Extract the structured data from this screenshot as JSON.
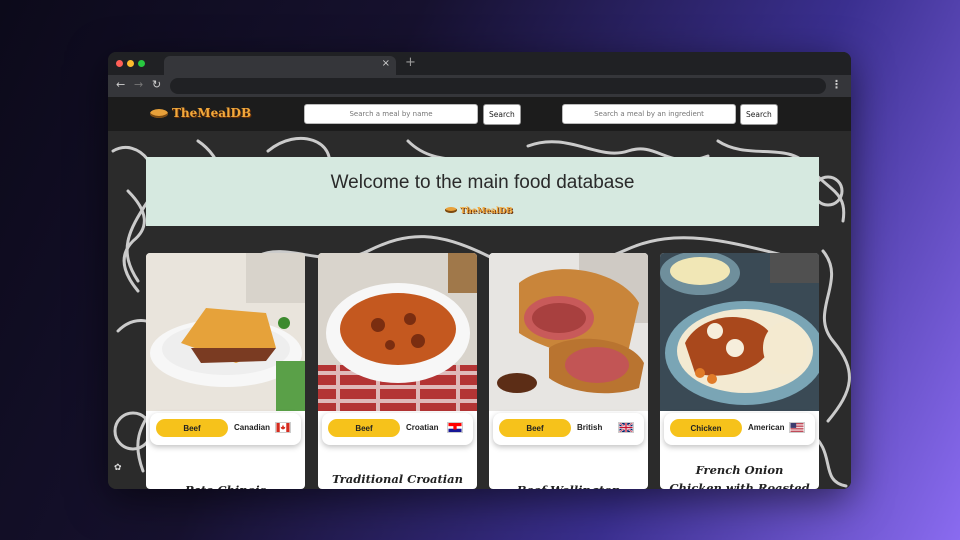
{
  "browser": {
    "tab_close": "×",
    "new_tab": "+",
    "back": "←",
    "forward": "→",
    "reload": "↻",
    "menu": "⋮",
    "url": ""
  },
  "site": {
    "logo_text": "TheMealDB",
    "search_name": {
      "placeholder": "Search a meal by name",
      "button": "Search"
    },
    "search_ingredient": {
      "placeholder": "Search a meal by an ingredient",
      "button": "Search"
    }
  },
  "hero": {
    "title": "Welcome to the main food database",
    "logo_text": "TheMealDB"
  },
  "cards": [
    {
      "category": "Beef",
      "area": "Canadian",
      "flag_icon": "canada-flag-icon",
      "name": "Pate Chinois"
    },
    {
      "category": "Beef",
      "area": "Croatian",
      "flag_icon": "croatia-flag-icon",
      "name": "Traditional Croatian"
    },
    {
      "category": "Beef",
      "area": "British",
      "flag_icon": "uk-flag-icon",
      "name": "Beef Wellington"
    },
    {
      "category": "Chicken",
      "area": "American",
      "flag_icon": "usa-flag-icon",
      "name": "French Onion Chicken with Roasted Carrots &"
    }
  ],
  "colors": {
    "category_pill": "#f6c21b",
    "hero_bg": "#d6e9e0",
    "header_bg": "#1c1c1c",
    "logo_orange": "#f3a93b"
  }
}
